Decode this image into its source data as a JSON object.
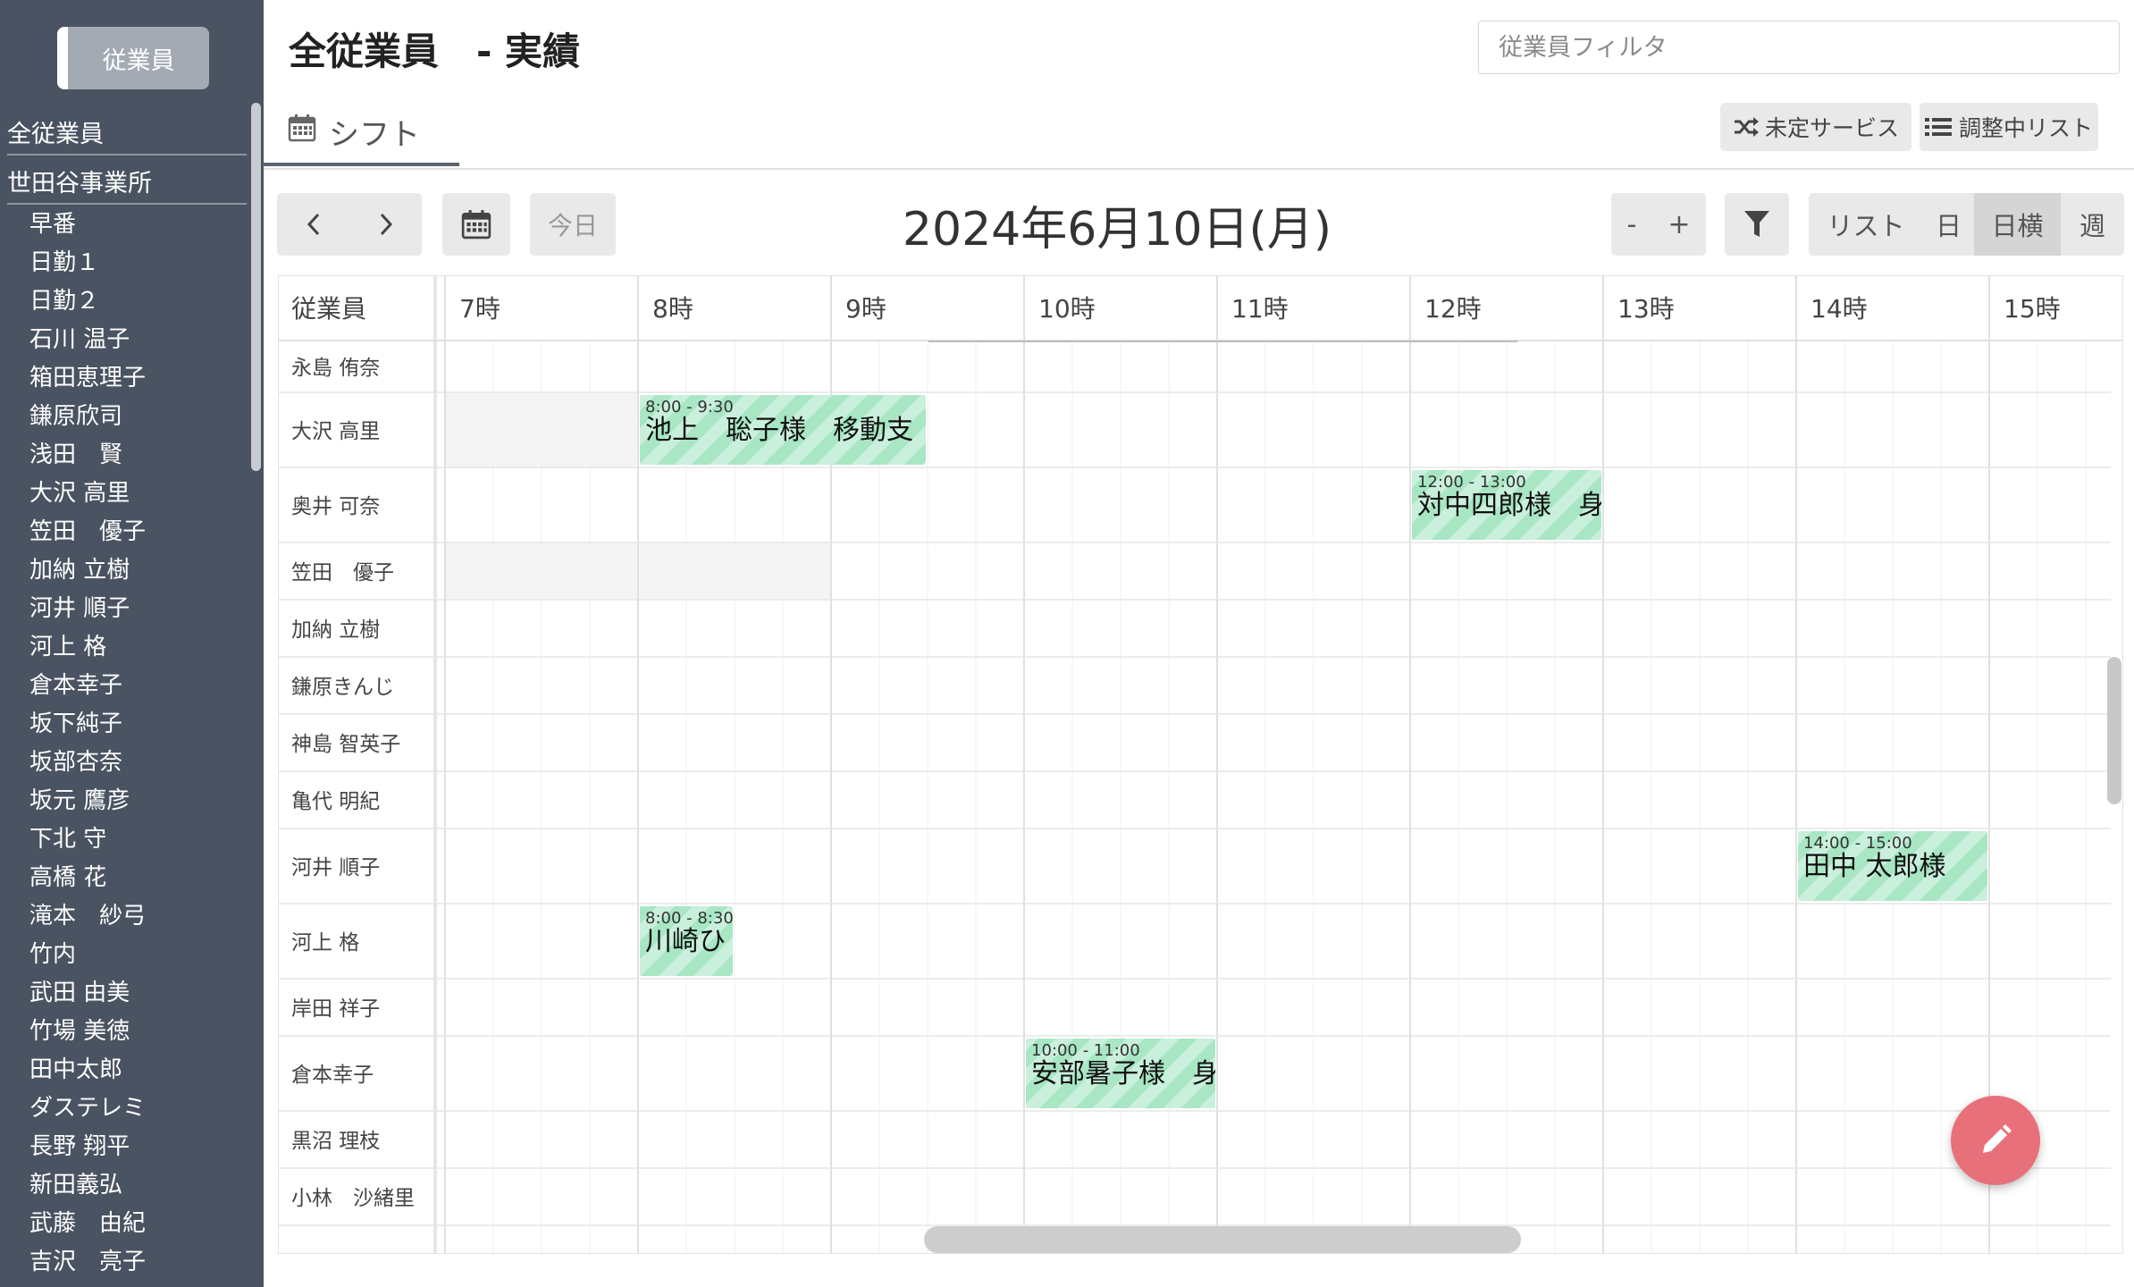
{
  "sidebar": {
    "employee_button": "従業員",
    "all_employees": "全従業員",
    "office": "世田谷事業所",
    "items": [
      "早番",
      "日勤１",
      "日勤２",
      "石川 温子",
      "箱田恵理子",
      "鎌原欣司",
      "浅田　賢",
      "大沢 高里",
      "笠田　優子",
      "加納 立樹",
      "河井 順子",
      "河上 格",
      "倉本幸子",
      "坂下純子",
      "坂部杏奈",
      "坂元 鷹彦",
      "下北 守",
      "高橋 花",
      "滝本　紗弓",
      "竹内",
      "武田 由美",
      "竹場 美徳",
      "田中太郎",
      "ダステレミ",
      "長野 翔平",
      "新田義弘",
      "武藤　由紀",
      "吉沢　亮子"
    ]
  },
  "header": {
    "title": "全従業員　- 実績",
    "filter_placeholder": "従業員フィルタ",
    "tab_shift": "シフト",
    "unassigned_btn": "未定サービス",
    "adjusting_btn": "調整中リスト"
  },
  "toolbar": {
    "today": "今日",
    "date": "2024年6月10日(月)",
    "minus": "-",
    "plus": "+",
    "views": [
      "リスト",
      "日",
      "日横",
      "週"
    ],
    "active_view": "日横"
  },
  "grid": {
    "col_header": "従業員",
    "hours": [
      "7時",
      "8時",
      "9時",
      "10時",
      "11時",
      "12時",
      "13時",
      "14時",
      "15時"
    ],
    "employees": [
      "永島 侑奈",
      "大沢 高里",
      "奥井 可奈",
      "笠田　優子",
      "加納 立樹",
      "鎌原きんじ",
      "神島 智英子",
      "亀代 明紀",
      "河井 順子",
      "河上 格",
      "岸田 祥子",
      "倉本幸子",
      "黒沼 理枝",
      "小林　沙緒里"
    ],
    "events": [
      {
        "employee": "大沢 高里",
        "time": "8:00 - 9:30",
        "title": "池上　聡子様　移動支"
      },
      {
        "employee": "奥井 可奈",
        "time": "12:00 - 13:00",
        "title": "対中四郎様　身"
      },
      {
        "employee": "河井 順子",
        "time": "14:00 - 15:00",
        "title": "田中 太郎様"
      },
      {
        "employee": "河上 格",
        "time": "8:00 - 8:30",
        "title": "川崎ひ"
      },
      {
        "employee": "倉本幸子",
        "time": "10:00 - 11:00",
        "title": "安部暑子様　身"
      }
    ]
  },
  "colors": {
    "sidebar_bg": "#4a5361",
    "event_green": "#a8e6c4",
    "fab": "#e8707a"
  }
}
